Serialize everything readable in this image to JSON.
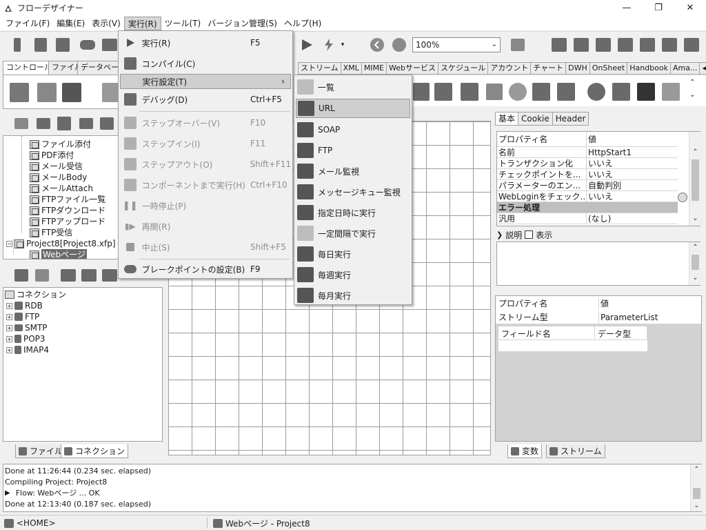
{
  "window": {
    "title": "フローデザイナー",
    "minimize": "—",
    "maximize": "❐",
    "close": "✕"
  },
  "menubar": {
    "items": [
      "ファイル(F)",
      "編集(E)",
      "表示(V)",
      "実行(R)",
      "ツール(T)",
      "バージョン管理(S)",
      "ヘルプ(H)"
    ]
  },
  "toolbar": {
    "zoom_value": "100%"
  },
  "left_tabs": [
    "コントロール",
    "ファイル",
    "データベース"
  ],
  "right_tabs": [
    "ストリーム",
    "XML",
    "MIME",
    "Webサービス",
    "スケジュール",
    "アカウント",
    "チャート",
    "DWH",
    "OnSheet",
    "Handbook",
    "Ama..."
  ],
  "tree": {
    "items": [
      "ファイル添付",
      "PDF添付",
      "メール受信",
      "メールBody",
      "メールAttach",
      "FTPファイル一覧",
      "FTPダウンロード",
      "FTPアップロード",
      "FTP受信"
    ],
    "project": "Project8[Project8.xfp]",
    "selected": "Webページ"
  },
  "connections": {
    "root": "コネクション",
    "items": [
      "RDB",
      "FTP",
      "SMTP",
      "POP3",
      "IMAP4"
    ]
  },
  "bottom_left_tabs": [
    "ファイル",
    "コネクション"
  ],
  "properties": {
    "tabs": [
      "基本",
      "Cookie",
      "Header"
    ],
    "header_name": "プロパティ名",
    "header_value": "値",
    "rows": [
      {
        "name": "名前",
        "value": "HttpStart1"
      },
      {
        "name": "トランザクション化",
        "value": "いいえ"
      },
      {
        "name": "チェックポイントを...",
        "value": "いいえ"
      },
      {
        "name": "パラメーターのエン...",
        "value": "自動判別"
      },
      {
        "name": "WebLoginをチェック...",
        "value": "いいえ"
      }
    ],
    "category": "エラー処理",
    "last_row": {
      "name": "汎用",
      "value": "(なし)"
    }
  },
  "description": {
    "label": "説明",
    "checkbox_label": "表示"
  },
  "stream": {
    "header_name": "プロパティ名",
    "header_value": "値",
    "row_name": "ストリーム型",
    "row_value": "ParameterList",
    "field_name": "フィールド名",
    "field_type": "データ型"
  },
  "bottom_right_tabs": [
    "変数",
    "ストリーム"
  ],
  "output": {
    "lines": [
      "Done at 11:26:44 (0.234 sec. elapsed)",
      "Compiling Project: Project8",
      "Flow: Webページ ... OK",
      "Done at 12:13:40 (0.187 sec. elapsed)"
    ]
  },
  "status": {
    "home": "<HOME>",
    "flow": "Webページ - Project8"
  },
  "run_menu": {
    "items": [
      {
        "label": "実行(R)",
        "key": "F5",
        "disabled": false
      },
      {
        "label": "コンパイル(C)",
        "key": "",
        "disabled": false
      },
      {
        "label": "実行設定(T)",
        "key": "",
        "disabled": false,
        "submenu": true
      },
      {
        "label": "デバッグ(D)",
        "key": "Ctrl+F5",
        "disabled": false
      },
      {
        "label": "ステップオーバー(V)",
        "key": "F10",
        "disabled": true
      },
      {
        "label": "ステップイン(I)",
        "key": "F11",
        "disabled": true
      },
      {
        "label": "ステップアウト(O)",
        "key": "Shift+F11",
        "disabled": true
      },
      {
        "label": "コンポーネントまで実行(H)",
        "key": "Ctrl+F10",
        "disabled": true
      },
      {
        "label": "一時停止(P)",
        "key": "",
        "disabled": true
      },
      {
        "label": "再開(R)",
        "key": "",
        "disabled": true
      },
      {
        "label": "中止(S)",
        "key": "Shift+F5",
        "disabled": true
      },
      {
        "label": "ブレークポイントの設定(B)",
        "key": "F9",
        "disabled": false
      }
    ],
    "submenu_arrow": "›"
  },
  "sub_menu": {
    "items": [
      "一覧",
      "URL",
      "SOAP",
      "FTP",
      "メール監視",
      "メッセージキュー監視",
      "指定日時に実行",
      "一定間隔で実行",
      "毎日実行",
      "毎週実行",
      "毎月実行"
    ]
  }
}
